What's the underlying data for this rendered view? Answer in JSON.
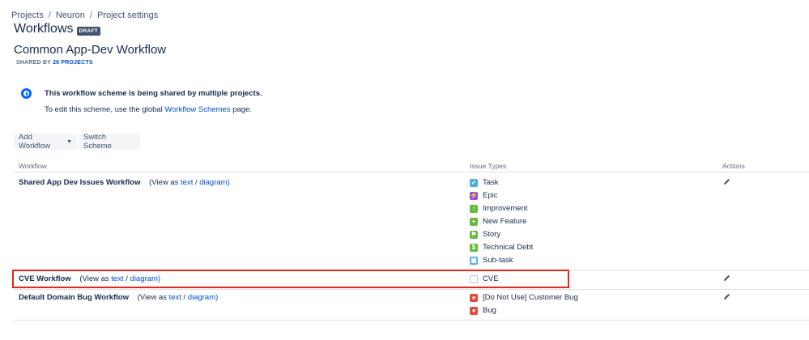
{
  "breadcrumb": {
    "items": [
      "Projects",
      "Neuron",
      "Project settings"
    ],
    "separator": "/"
  },
  "page": {
    "title": "Workflows",
    "badge": "DRAFT",
    "scheme_name": "Common App-Dev Workflow",
    "shared_prefix": "SHARED BY",
    "shared_link": "26 PROJECTS"
  },
  "info": {
    "title": "This workflow scheme is being shared by multiple projects.",
    "body_prefix": "To edit this scheme, use the global",
    "body_link": "Workflow Schemes",
    "body_suffix": "page."
  },
  "toolbar": {
    "add_workflow": "Add Workflow",
    "switch_scheme": "Switch Scheme"
  },
  "table": {
    "headers": {
      "workflow": "Workflow",
      "issue_types": "Issue Types",
      "actions": "Actions"
    },
    "view_as": "(View as",
    "text_link": "text",
    "slash": "/",
    "diagram_link": "diagram)",
    "rows": [
      {
        "name": "Shared App Dev Issues Workflow",
        "issue_types": [
          {
            "label": "Task",
            "icon": "task-icon",
            "color": "#4bade8"
          },
          {
            "label": "Epic",
            "icon": "epic-icon",
            "color": "#904ee2"
          },
          {
            "label": "Improvement",
            "icon": "improvement-icon",
            "color": "#63ba3c"
          },
          {
            "label": "New Feature",
            "icon": "new-feature-icon",
            "color": "#63ba3c"
          },
          {
            "label": "Story",
            "icon": "story-icon",
            "color": "#63ba3c"
          },
          {
            "label": "Technical Debt",
            "icon": "technical-debt-icon",
            "color": "#63ba3c"
          },
          {
            "label": "Sub-task",
            "icon": "subtask-icon",
            "color": "#4bade8"
          }
        ]
      },
      {
        "name": "CVE Workflow",
        "issue_types": [
          {
            "label": "CVE",
            "icon": "cve-icon",
            "color": "#c1c7d0"
          }
        ]
      },
      {
        "name": "Default Domain Bug Workflow",
        "issue_types": [
          {
            "label": "[Do Not Use] Customer Bug",
            "icon": "bug-icon",
            "color": "#e5493a"
          },
          {
            "label": "Bug",
            "icon": "bug-icon",
            "color": "#e5493a"
          }
        ]
      }
    ]
  },
  "colors": {
    "link": "#0052cc",
    "highlight": "#e5261d",
    "info": "#0065ff"
  }
}
